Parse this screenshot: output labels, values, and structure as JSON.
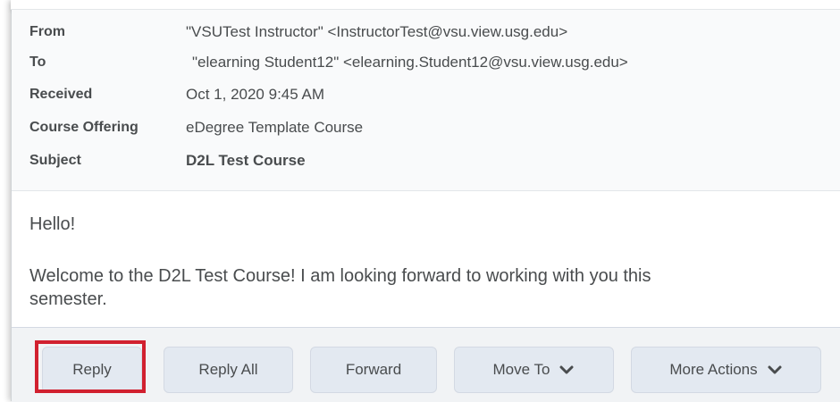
{
  "header": {
    "rows": [
      {
        "label": "From",
        "value": "\"VSUTest Instructor\" <InstructorTest@vsu.view.usg.edu>"
      },
      {
        "label": "To",
        "value": "\"elearning Student12\" <elearning.Student12@vsu.view.usg.edu>"
      },
      {
        "label": "Received",
        "value": "Oct 1, 2020 9:45 AM"
      },
      {
        "label": "Course Offering",
        "value": "eDegree Template Course"
      },
      {
        "label": "Subject",
        "value": "D2L Test Course"
      }
    ]
  },
  "body": {
    "greeting": "Hello!",
    "line1": "Welcome to the D2L Test Course! I am looking forward to working with you this",
    "line2": "semester."
  },
  "toolbar": {
    "reply": "Reply",
    "reply_all": "Reply All",
    "forward": "Forward",
    "move_to": "Move To",
    "more_actions": "More Actions"
  },
  "icons": {
    "dropdown": "chevron-down-icon"
  },
  "colors": {
    "highlight": "#d1202f",
    "button_bg": "#e3e9f1",
    "header_bg": "#f9fafb",
    "text": "#494c4e"
  }
}
